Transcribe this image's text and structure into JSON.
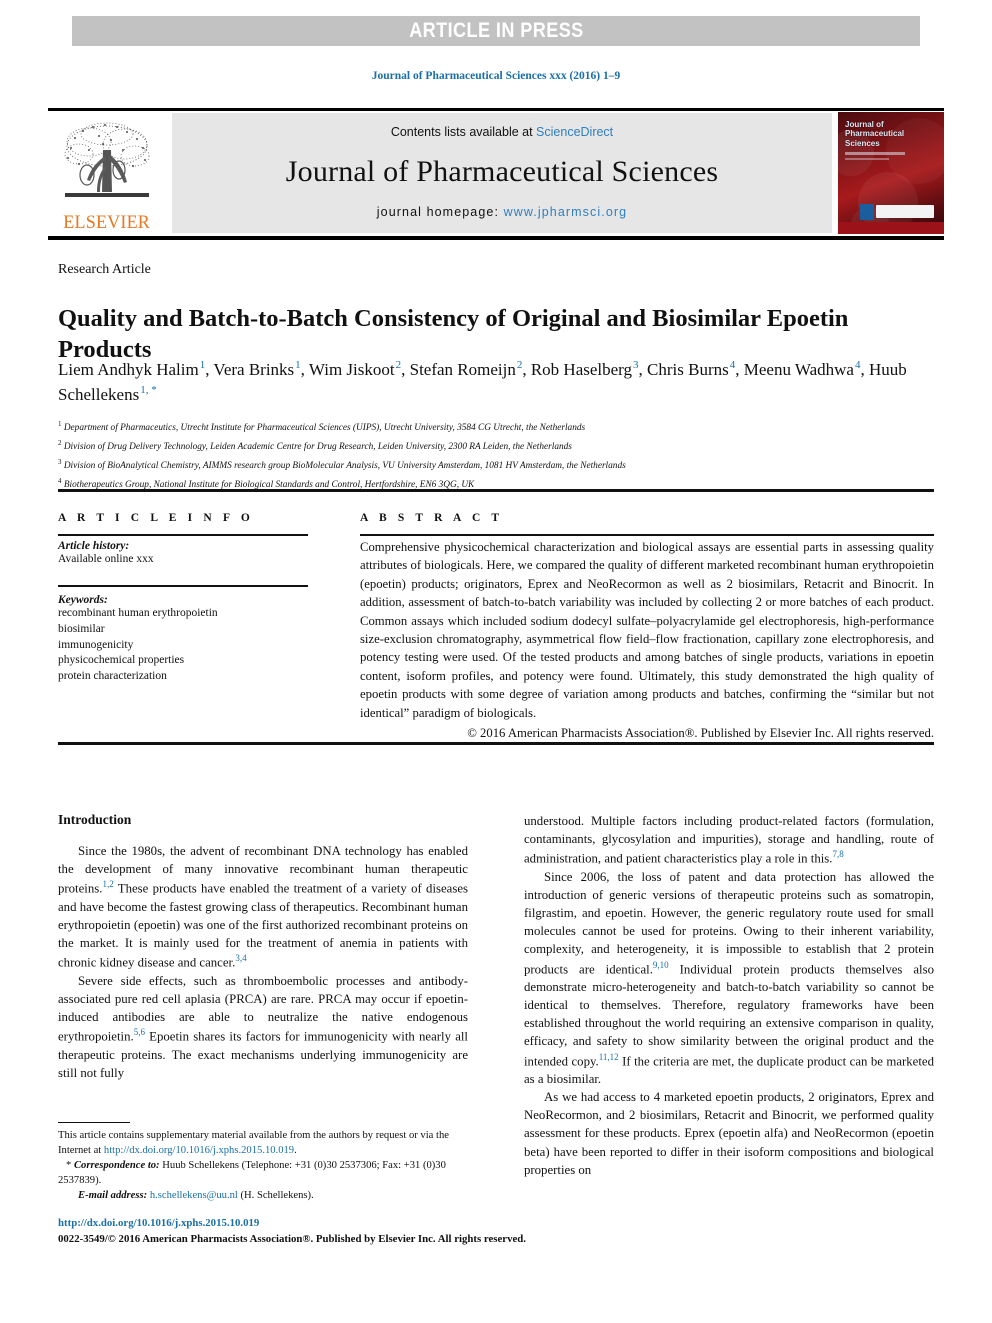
{
  "banner": {
    "text": "ARTICLE IN PRESS"
  },
  "running_head": "Journal of Pharmaceutical Sciences xxx (2016) 1–9",
  "masthead": {
    "contents_prefix": "Contents lists available at ",
    "contents_link": "ScienceDirect",
    "journal_title": "Journal of Pharmaceutical Sciences",
    "homepage_prefix": "journal homepage: ",
    "homepage_url": "www.jpharmsci.org",
    "publisher": "ELSEVIER",
    "cover_title_line1": "Journal of",
    "cover_title_line2": "Pharmaceutical",
    "cover_title_line3": "Sciences"
  },
  "article": {
    "type": "Research Article",
    "title": "Quality and Batch-to-Batch Consistency of Original and Biosimilar Epoetin Products",
    "authors": [
      {
        "name": "Liem Andhyk Halim",
        "sup": "1",
        "sep": ", "
      },
      {
        "name": "Vera Brinks",
        "sup": "1",
        "sep": ", "
      },
      {
        "name": "Wim Jiskoot",
        "sup": "2",
        "sep": ", "
      },
      {
        "name": "Stefan Romeijn",
        "sup": "2",
        "sep": ", "
      },
      {
        "name": "Rob Haselberg",
        "sup": "3",
        "sep": ", "
      },
      {
        "name": "Chris Burns",
        "sup": "4",
        "sep": ", "
      },
      {
        "name": "Meenu Wadhwa",
        "sup": "4",
        "sep": ", "
      },
      {
        "name": "Huub Schellekens",
        "sup": "1, *",
        "sep": ""
      }
    ],
    "affiliations": [
      {
        "marker": "1",
        "text": "Department of Pharmaceutics, Utrecht Institute for Pharmaceutical Sciences (UIPS), Utrecht University, 3584 CG Utrecht, the Netherlands"
      },
      {
        "marker": "2",
        "text": "Division of Drug Delivery Technology, Leiden Academic Centre for Drug Research, Leiden University, 2300 RA Leiden, the Netherlands"
      },
      {
        "marker": "3",
        "text": "Division of BioAnalytical Chemistry, AIMMS research group BioMolecular Analysis, VU University Amsterdam, 1081 HV Amsterdam, the Netherlands"
      },
      {
        "marker": "4",
        "text": "Biotherapeutics Group, National Institute for Biological Standards and Control, Hertfordshire, EN6 3QG, UK"
      }
    ]
  },
  "article_info": {
    "header": "A R T I C L E  I N F O",
    "history_label": "Article history:",
    "history_value": "Available online xxx",
    "keywords_label": "Keywords:",
    "keywords": [
      "recombinant human erythropoietin",
      "biosimilar",
      "immunogenicity",
      "physicochemical properties",
      "protein characterization"
    ]
  },
  "abstract": {
    "header": "A B S T R A C T",
    "text": "Comprehensive physicochemical characterization and biological assays are essential parts in assessing quality attributes of biologicals. Here, we compared the quality of different marketed recombinant human erythropoietin (epoetin) products; originators, Eprex and NeoRecormon as well as 2 biosimilars, Retacrit and Binocrit. In addition, assessment of batch-to-batch variability was included by collecting 2 or more batches of each product. Common assays which included sodium dodecyl sulfate–polyacrylamide gel electrophoresis, high-performance size-exclusion chromatography, asymmetrical flow field–flow fractionation, capillary zone electrophoresis, and potency testing were used. Of the tested products and among batches of single products, variations in epoetin content, isoform profiles, and potency were found. Ultimately, this study demonstrated the high quality of epoetin products with some degree of variation among products and batches, confirming the “similar but not identical” paradigm of biologicals.",
    "copyright": "© 2016 American Pharmacists Association®. Published by Elsevier Inc. All rights reserved."
  },
  "body": {
    "section_title": "Introduction",
    "left_paragraphs": [
      {
        "parts": [
          {
            "t": "Since the 1980s, the advent of recombinant DNA technology has enabled the development of many innovative recombinant human therapeutic proteins."
          },
          {
            "sup": "1,2"
          },
          {
            "t": " These products have enabled the treatment of a variety of diseases and have become the fastest growing class of therapeutics. Recombinant human erythropoietin (epoetin) was one of the first authorized recombinant proteins on the market. It is mainly used for the treatment of anemia in patients with chronic kidney disease and cancer."
          },
          {
            "sup": "3,4"
          }
        ]
      },
      {
        "parts": [
          {
            "t": "Severe side effects, such as thromboembolic processes and antibody-associated pure red cell aplasia (PRCA) are rare. PRCA may occur if epoetin-induced antibodies are able to neutralize the native endogenous erythropoietin."
          },
          {
            "sup": "5,6"
          },
          {
            "t": " Epoetin shares its factors for immunogenicity with nearly all therapeutic proteins. The exact mechanisms underlying immunogenicity are still not fully"
          }
        ]
      }
    ],
    "right_paragraphs": [
      {
        "indent": false,
        "parts": [
          {
            "t": "understood. Multiple factors including product-related factors (formulation, contaminants, glycosylation and impurities), storage and handling, route of administration, and patient characteristics play a role in this."
          },
          {
            "sup": "7,8"
          }
        ]
      },
      {
        "indent": true,
        "parts": [
          {
            "t": "Since 2006, the loss of patent and data protection has allowed the introduction of generic versions of therapeutic proteins such as somatropin, filgrastim, and epoetin. However, the generic regulatory route used for small molecules cannot be used for proteins. Owing to their inherent variability, complexity, and heterogeneity, it is impossible to establish that 2 protein products are identical."
          },
          {
            "sup": "9,10"
          },
          {
            "t": " Individual protein products themselves also demonstrate micro-heterogeneity and batch-to-batch variability so cannot be identical to themselves. Therefore, regulatory frameworks have been established throughout the world requiring an extensive comparison in quality, efficacy, and safety to show similarity between the original product and the intended copy."
          },
          {
            "sup": "11,12"
          },
          {
            "t": " If the criteria are met, the duplicate product can be marketed as a biosimilar."
          }
        ]
      },
      {
        "indent": true,
        "parts": [
          {
            "t": "As we had access to 4 marketed epoetin products, 2 originators, Eprex and NeoRecormon, and 2 biosimilars, Retacrit and Binocrit, we performed quality assessment for these products. Eprex (epoetin alfa) and NeoRecormon (epoetin beta) have been reported to differ in their isoform compositions and biological properties on"
          }
        ]
      }
    ]
  },
  "footnotes": {
    "supplementary_prefix": "This article contains supplementary material available from the authors by request or via the Internet at ",
    "supplementary_link": "http://dx.doi.org/10.1016/j.xphs.2015.10.019",
    "supplementary_suffix": ".",
    "correspondence_label": "Correspondence to:",
    "correspondence_text": " Huub Schellekens (Telephone: +31 (0)30 2537306; Fax: +31 (0)30 2537839).",
    "email_label": "E-mail address:",
    "email_link": "h.schellekens@uu.nl",
    "email_suffix": " (H. Schellekens)."
  },
  "bottom": {
    "doi": "http://dx.doi.org/10.1016/j.xphs.2015.10.019",
    "issn_line": "0022-3549/© 2016 American Pharmacists Association®. Published by Elsevier Inc. All rights reserved."
  },
  "colors": {
    "link": "#1a6fa8",
    "elsevier_orange": "#e87722",
    "banner_gray": "#c2c2c2",
    "masthead_gray": "#e6e6e6"
  }
}
